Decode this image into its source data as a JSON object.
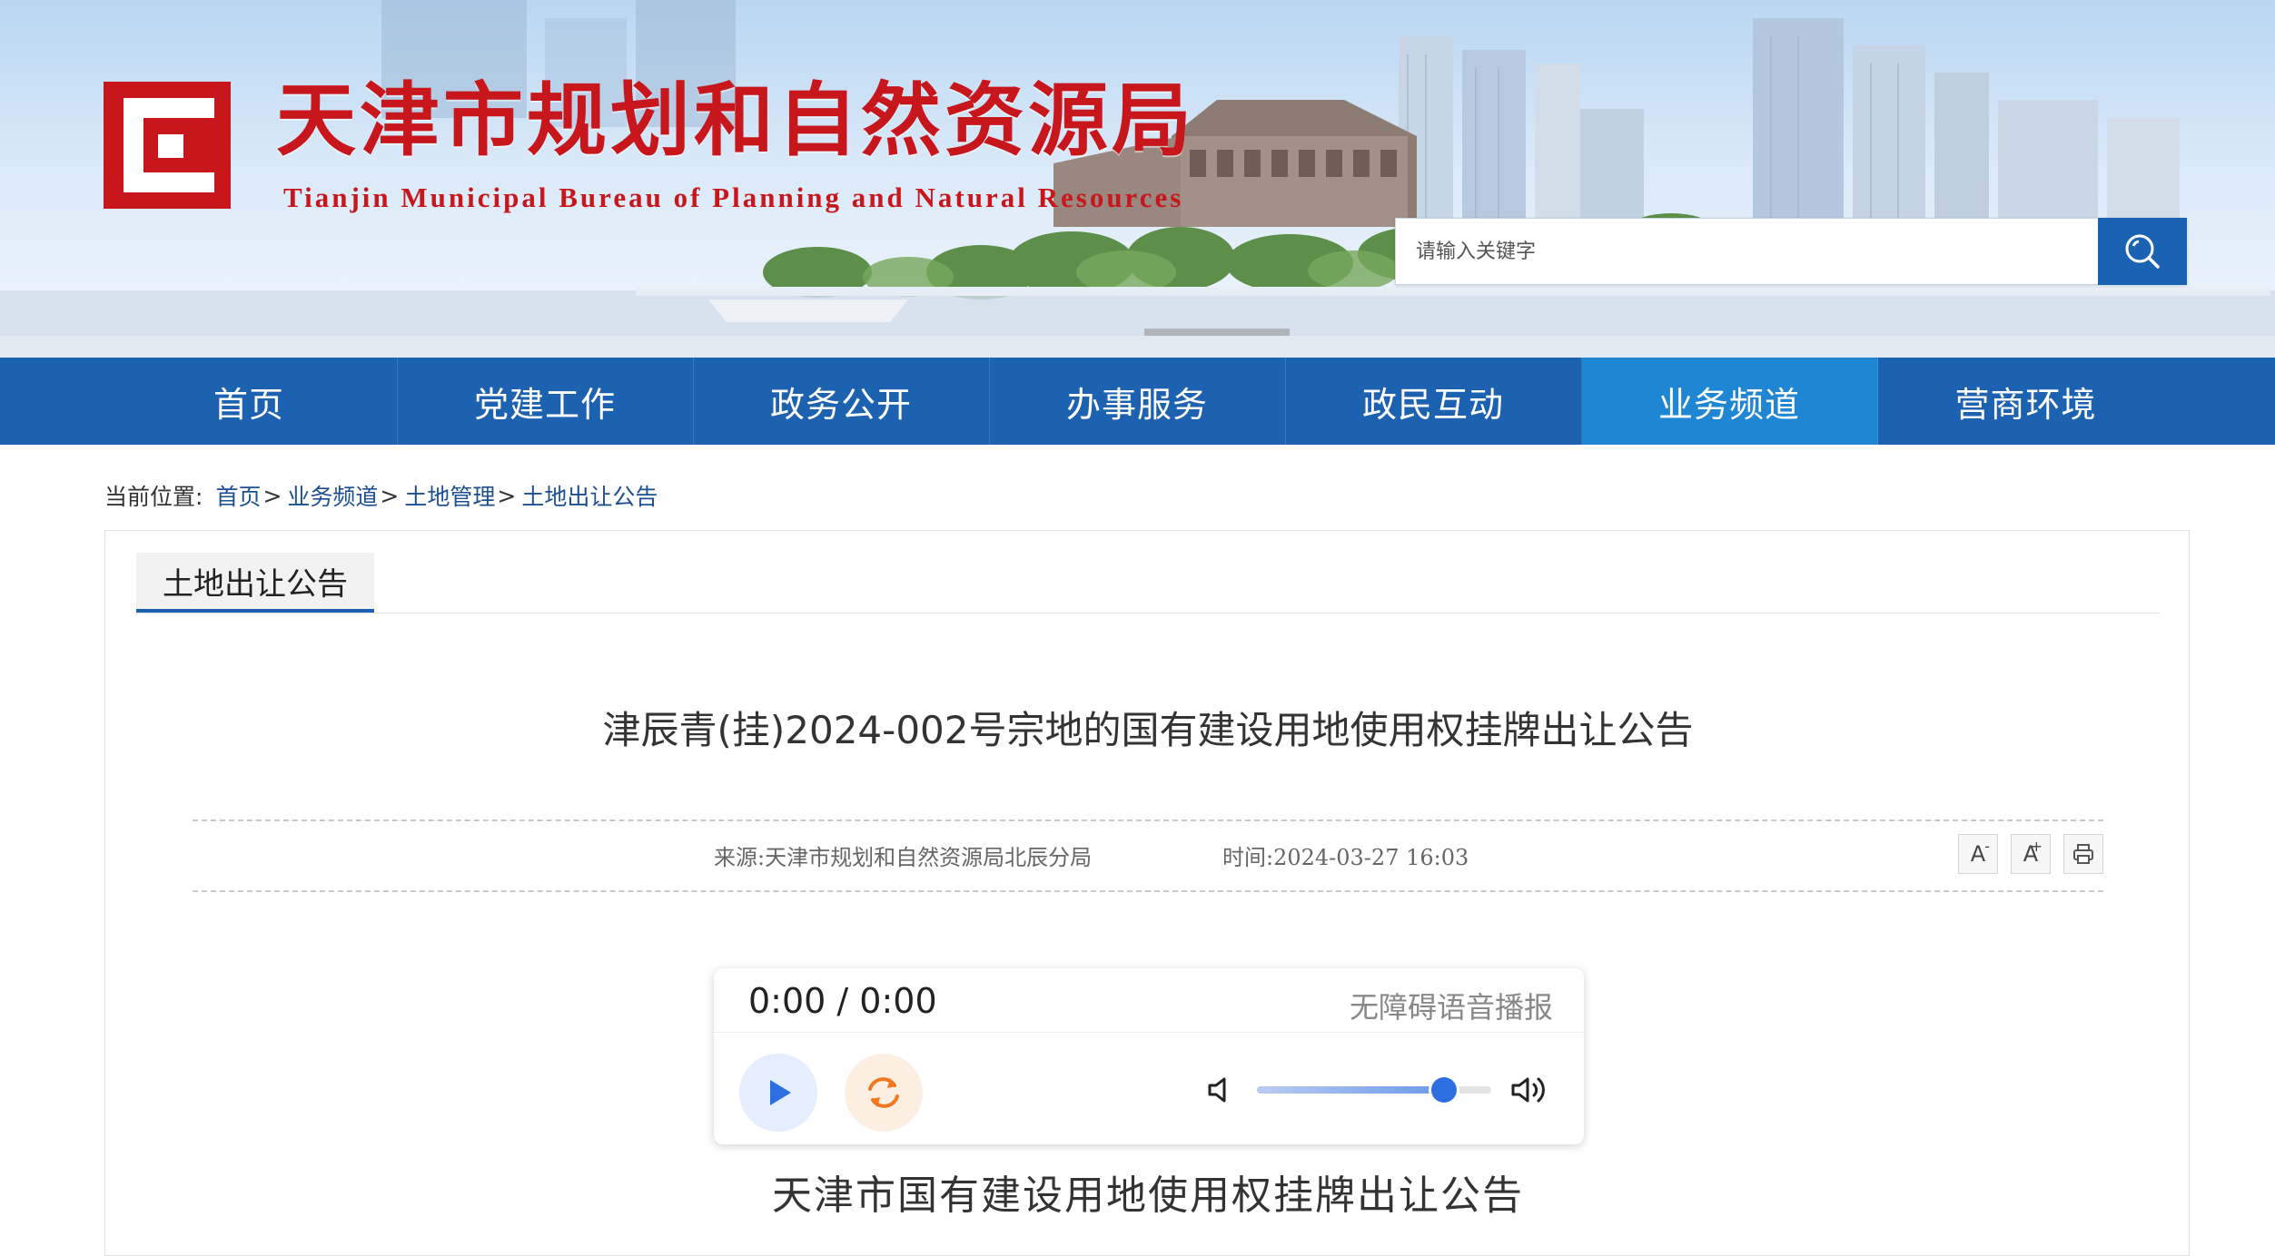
{
  "header": {
    "title": "天津市规划和自然资源局",
    "subtitle": "Tianjin Municipal Bureau of Planning and Natural Resources",
    "search_placeholder": "请输入关键字"
  },
  "nav": {
    "items": [
      {
        "label": "首页"
      },
      {
        "label": "党建工作"
      },
      {
        "label": "政务公开"
      },
      {
        "label": "办事服务"
      },
      {
        "label": "政民互动"
      },
      {
        "label": "业务频道",
        "active": true
      },
      {
        "label": "营商环境"
      }
    ]
  },
  "breadcrumb": {
    "prefix": "当前位置:",
    "items": [
      "首页",
      "业务频道",
      "土地管理",
      "土地出让公告"
    ],
    "separator": ">"
  },
  "tab": {
    "label": "土地出让公告"
  },
  "article": {
    "title": "津辰青(挂)2024-002号宗地的国有建设用地使用权挂牌出让公告",
    "source": "来源:天津市规划和自然资源局北辰分局",
    "time": "时间:2024-03-27 16:03",
    "tools": {
      "font_smaller": "A",
      "font_smaller_mark": "-",
      "font_larger": "A",
      "font_larger_mark": "+",
      "print_icon": "print-icon"
    },
    "doc_heading": "天津市国有建设用地使用权挂牌出让公告"
  },
  "player": {
    "time": "0:00 / 0:00",
    "label": "无障碍语音播报",
    "volume_level": 0.8
  },
  "colors": {
    "brand_red": "#c8161d",
    "nav_blue": "#1d62b0",
    "nav_active": "#1f86d3"
  }
}
